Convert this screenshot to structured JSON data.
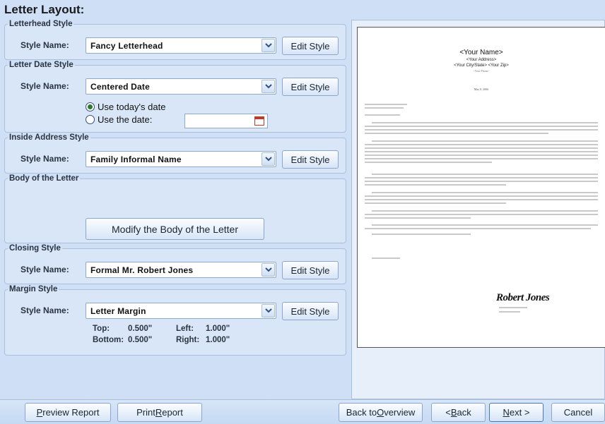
{
  "title": "Letter Layout:",
  "letterhead": {
    "legend": "Letterhead Style",
    "label": "Style Name:",
    "value": "Fancy Letterhead",
    "edit": "Edit Style"
  },
  "date_style": {
    "legend": "Letter Date Style",
    "label": "Style Name:",
    "value": "Centered Date",
    "edit": "Edit Style",
    "option_today": "Use today's date",
    "option_date": "Use the date:",
    "date_value": ""
  },
  "inside_address": {
    "legend": "Inside Address Style",
    "label": "Style Name:",
    "value": "Family Informal Name",
    "edit": "Edit Style"
  },
  "body": {
    "legend": "Body of the Letter",
    "button": "Modify the Body of the Letter"
  },
  "closing": {
    "legend": "Closing Style",
    "label": "Style Name:",
    "value": "Formal Mr. Robert Jones",
    "edit": "Edit Style"
  },
  "margin": {
    "legend": "Margin Style",
    "label": "Style Name:",
    "value": "Letter Margin",
    "edit": "Edit Style",
    "top_label": "Top:",
    "top_value": "0.500\"",
    "left_label": "Left:",
    "left_value": "1.000\"",
    "bottom_label": "Bottom:",
    "bottom_value": "0.500\"",
    "right_label": "Right:",
    "right_value": "1.000\""
  },
  "preview": {
    "name": "<Your Name>",
    "address": "<Your Address>",
    "city_state_zip": "<Your City/State>   <Your Zip>",
    "phone": "<Your Phone>",
    "date": "May 8, 2006",
    "signature": "Robert Jones"
  },
  "buttons": {
    "preview_report_pre": "P",
    "preview_report_rest": "review Report",
    "print_report_pre": "Print ",
    "print_report_u": "R",
    "print_report_rest": "eport",
    "back_overview_pre": "Back to ",
    "back_overview_u": "O",
    "back_overview_rest": "verview",
    "back_pre": "< ",
    "back_u": "B",
    "back_rest": "ack",
    "next_u": "N",
    "next_rest": "ext >",
    "cancel": "Cancel"
  }
}
